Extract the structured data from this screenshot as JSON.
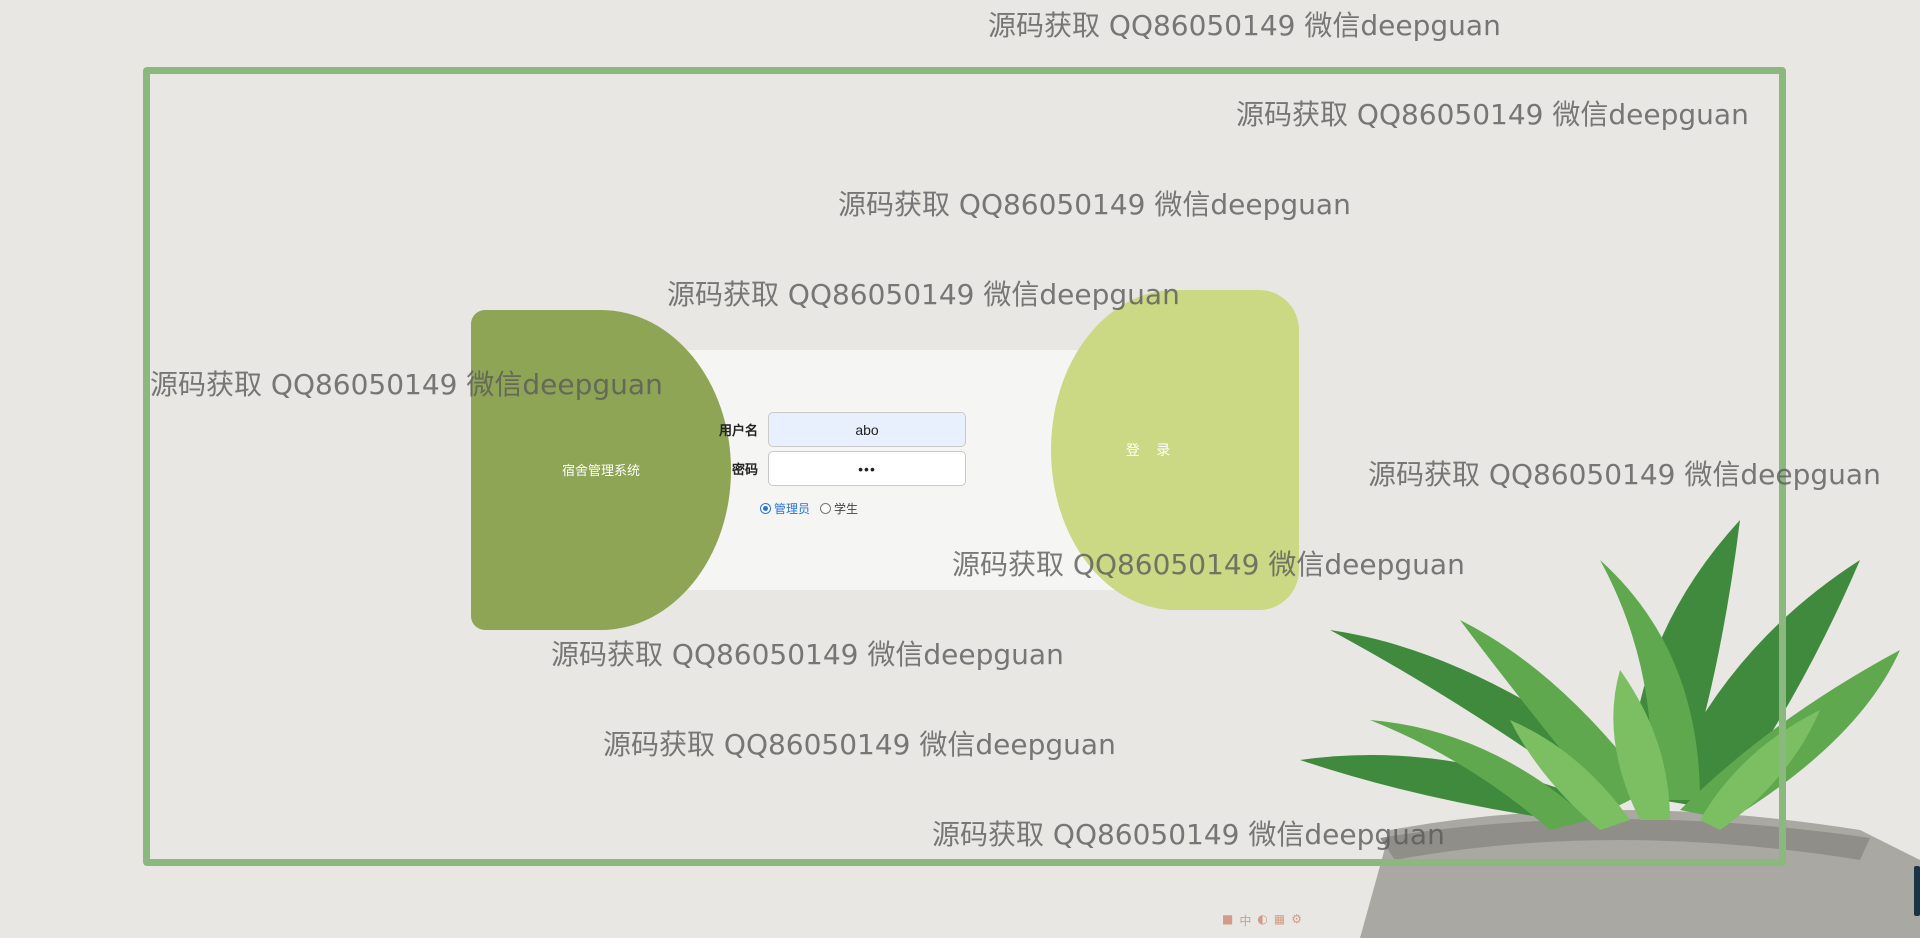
{
  "app": {
    "system_title": "宿舍管理系统",
    "login_button": "登 录"
  },
  "form": {
    "username_label": "用户名",
    "username_value": "abo",
    "password_label": "密码",
    "password_value": "•••"
  },
  "roles": {
    "options": [
      "管理员",
      "学生"
    ],
    "selected": "管理员"
  },
  "watermark_text": "源码获取 QQ86050149 微信deepguan",
  "tray": {
    "label": "中"
  },
  "colors": {
    "frame": "#8bb87e",
    "left_blob": "#8da555",
    "right_blob": "#cbd884",
    "background": "#e8e7e3"
  }
}
